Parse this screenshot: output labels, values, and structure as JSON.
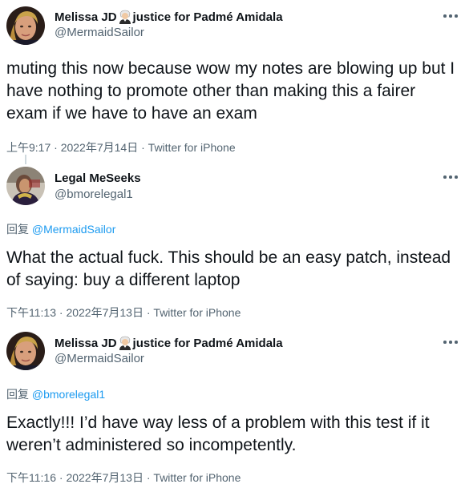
{
  "tweets": [
    {
      "name": "Melissa JD",
      "name_suffix": "justice for Padmé Amidala",
      "handle": "@MermaidSailor",
      "text": "muting this now because wow my notes are blowing up but I have nothing to promote other than making this a fairer exam if we have to have an exam",
      "time": "上午9:17",
      "date": "2022年7月14日",
      "source": "Twitter for iPhone"
    },
    {
      "name": "Legal MeSeeks",
      "handle": "@bmorelegal1",
      "reply_prefix": "回复",
      "reply_to": "@MermaidSailor",
      "text": "What the actual fuck. This should be an easy patch, instead of saying: buy a different laptop",
      "time": "下午11:13",
      "date": "2022年7月13日",
      "source": "Twitter for iPhone"
    },
    {
      "name": "Melissa JD",
      "name_suffix": "justice for Padmé Amidala",
      "handle": "@MermaidSailor",
      "reply_prefix": "回复",
      "reply_to": "@bmorelegal1",
      "text": "Exactly!!! I’d have way less of a problem with this test if it weren’t administered so incompetently.",
      "time": "下午11:16",
      "date": "2022年7月13日",
      "source": "Twitter for iPhone"
    }
  ],
  "meta_separator": "·",
  "colors": {
    "text": "#0f1419",
    "secondary": "#536471",
    "link": "#1d9bf0",
    "divider": "#cfd9de"
  },
  "icons": {
    "more": "more-options-icon",
    "name_emoji": "judge-emoji-icon"
  }
}
